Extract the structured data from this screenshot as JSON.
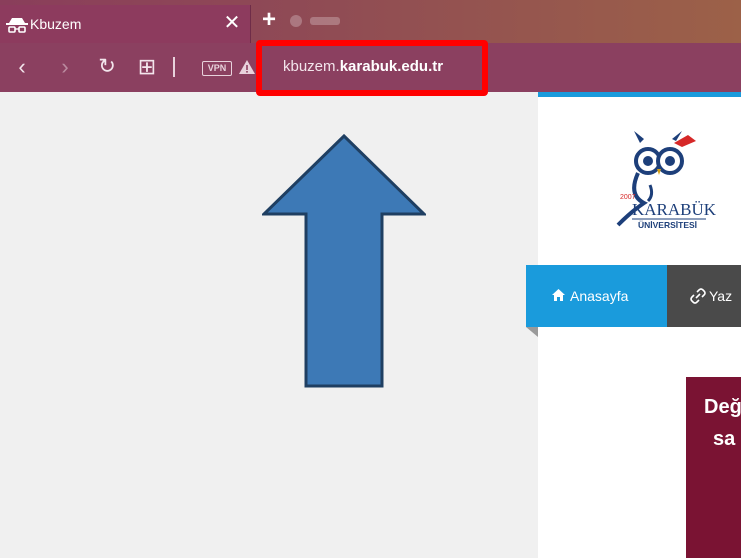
{
  "browser": {
    "tab_title": "Kbuzem",
    "close_glyph": "✕",
    "newtab_glyph": "+",
    "nav": {
      "back_glyph": "‹",
      "forward_glyph": "›",
      "reload_glyph": "↻",
      "grid_glyph": "⊞",
      "vpn_label": "VPN"
    },
    "url_host": "kbuzem.",
    "url_domain": "karabuk.edu.tr"
  },
  "page": {
    "logo": {
      "year": "2007",
      "name": "KARABÜK",
      "sub": "ÜNİVERSİTESİ"
    },
    "menu": {
      "home_label": "Anasayfa",
      "second_label": "Yaz"
    },
    "banner": {
      "line1": "Değ",
      "line2": "sa"
    }
  },
  "colors": {
    "highlight": "#ff0000",
    "arrow_fill": "#3d79b6",
    "accent_blue": "#1a9bdc",
    "banner": "#7a1333"
  }
}
